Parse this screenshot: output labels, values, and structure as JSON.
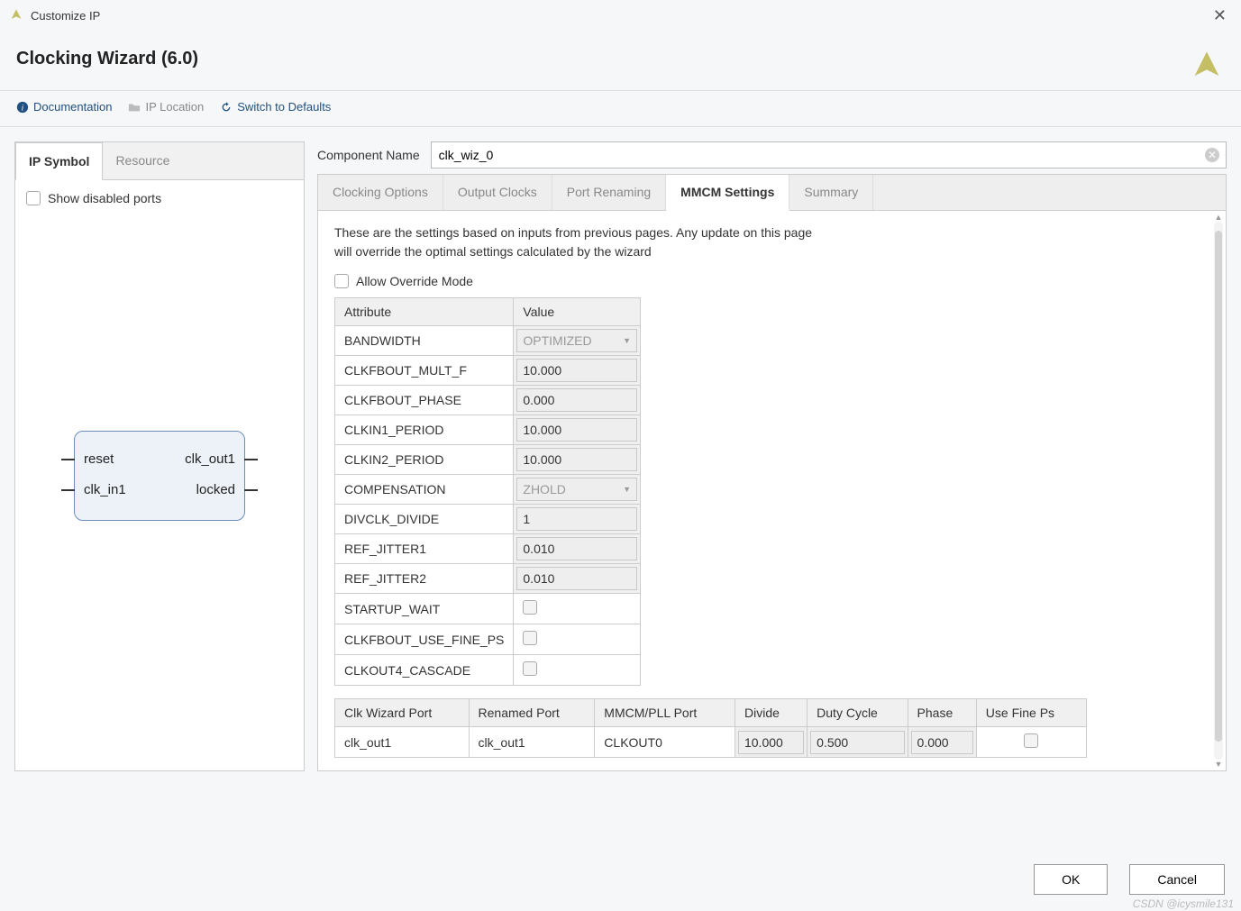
{
  "window": {
    "title": "Customize IP"
  },
  "header": {
    "heading": "Clocking Wizard (6.0)"
  },
  "toolbar": {
    "doc": "Documentation",
    "iploc": "IP Location",
    "defaults": "Switch to Defaults"
  },
  "leftpanel": {
    "tabs": {
      "symbol": "IP Symbol",
      "resource": "Resource"
    },
    "show_disabled": "Show disabled ports",
    "ports": {
      "reset": "reset",
      "clk_in1": "clk_in1",
      "clk_out1": "clk_out1",
      "locked": "locked"
    }
  },
  "comp": {
    "label": "Component Name",
    "value": "clk_wiz_0"
  },
  "rtabs": {
    "clocking": "Clocking Options",
    "output": "Output Clocks",
    "rename": "Port Renaming",
    "mmcm": "MMCM Settings",
    "summary": "Summary"
  },
  "settings": {
    "desc1": "These are the settings based on inputs from previous pages. Any update on this page",
    "desc2": "will override the optimal settings calculated by the wizard",
    "override": "Allow Override Mode",
    "headers": {
      "attr": "Attribute",
      "val": "Value"
    },
    "rows": [
      {
        "attr": "BANDWIDTH",
        "value": "OPTIMIZED",
        "type": "select"
      },
      {
        "attr": "CLKFBOUT_MULT_F",
        "value": "10.000",
        "type": "num"
      },
      {
        "attr": "CLKFBOUT_PHASE",
        "value": "0.000",
        "type": "num"
      },
      {
        "attr": "CLKIN1_PERIOD",
        "value": "10.000",
        "type": "num"
      },
      {
        "attr": "CLKIN2_PERIOD",
        "value": "10.000",
        "type": "num"
      },
      {
        "attr": "COMPENSATION",
        "value": "ZHOLD",
        "type": "select"
      },
      {
        "attr": "DIVCLK_DIVIDE",
        "value": "1",
        "type": "num"
      },
      {
        "attr": "REF_JITTER1",
        "value": "0.010",
        "type": "num"
      },
      {
        "attr": "REF_JITTER2",
        "value": "0.010",
        "type": "num"
      },
      {
        "attr": "STARTUP_WAIT",
        "value": "",
        "type": "check"
      },
      {
        "attr": "CLKFBOUT_USE_FINE_PS",
        "value": "",
        "type": "check"
      },
      {
        "attr": "CLKOUT4_CASCADE",
        "value": "",
        "type": "check"
      }
    ]
  },
  "porttable": {
    "headers": {
      "wizport": "Clk Wizard Port",
      "renamed": "Renamed Port",
      "mmcm": "MMCM/PLL Port",
      "divide": "Divide",
      "duty": "Duty Cycle",
      "phase": "Phase",
      "fineps": "Use Fine Ps"
    },
    "row": {
      "wizport": "clk_out1",
      "renamed": "clk_out1",
      "mmcm": "CLKOUT0",
      "divide": "10.000",
      "duty": "0.500",
      "phase": "0.000"
    }
  },
  "footer": {
    "ok": "OK",
    "cancel": "Cancel"
  },
  "watermark": "CSDN @icysmile131"
}
